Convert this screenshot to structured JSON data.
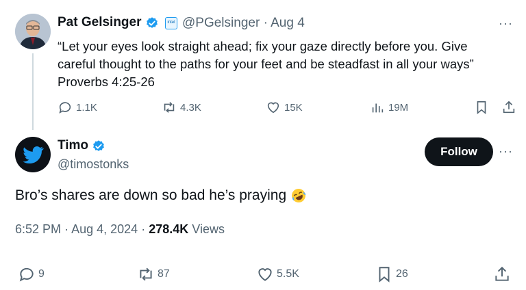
{
  "parent_tweet": {
    "author_name": "Pat Gelsinger",
    "handle": "@PGelsinger",
    "separator": "·",
    "date": "Aug 4",
    "badge_text": "intel",
    "text_line1": "“Let your eyes look straight ahead; fix your gaze directly before you. Give",
    "text_line2": "careful thought to the paths for your feet and be steadfast in all your ways”",
    "text_line3": "Proverbs 4:25-26",
    "replies": "1.1K",
    "reposts": "4.3K",
    "likes": "15K",
    "views": "19M"
  },
  "reply_tweet": {
    "author_name": "Timo",
    "handle": "@timostonks",
    "follow_label": "Follow",
    "text": "Bro’s shares are down so bad he’s praying",
    "time": "6:52 PM",
    "date": "Aug 4, 2024",
    "separator": "·",
    "views_count": "278.4K",
    "views_label": "Views",
    "replies": "9",
    "reposts": "87",
    "likes": "5.5K",
    "bookmarks": "26"
  },
  "more_glyph": "···",
  "colors": {
    "verified_blue": "#1d9bf0",
    "text_primary": "#0f1419",
    "text_muted": "#536471",
    "button_dark": "#0f1419"
  }
}
